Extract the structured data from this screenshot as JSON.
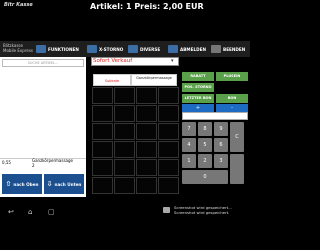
{
  "app": {
    "logo_text": "Bitr Kasse",
    "status_text": "Artikel: 1   Preis: 2,00 EUR"
  },
  "toolbar": {
    "title_line1": "Blitzkasse",
    "title_line2": "Mobile Express",
    "buttons": [
      {
        "label": "FUNKTIONEN",
        "icon": "grid-icon"
      },
      {
        "label": "X-STORNO",
        "icon": "x-storno-icon"
      },
      {
        "label": "DIVERSE",
        "icon": "diverse-icon"
      },
      {
        "label": "ABMELDEN",
        "icon": "logout-icon"
      },
      {
        "label": "BEENDEN",
        "icon": "power-icon"
      }
    ]
  },
  "left": {
    "search_placeholder": "SUCHE ARTIKEL...",
    "count_label": "0,55",
    "sum_label": "Ganzkörpermassage",
    "sum_value": "2",
    "nav_up": "nach Oben",
    "nav_down": "nach Unten"
  },
  "middle": {
    "select_value": "Sofort Verkauf",
    "tab_subkat": "Subkate",
    "tab_gesamt": "Ganzkörpermassage"
  },
  "keypad": {
    "green_buttons": [
      "RABATT",
      "PLUSEIN",
      "POS. STORNO",
      "LETZTER BON",
      "BON"
    ],
    "blue_buttons": [
      "+",
      "-"
    ],
    "keys": [
      "7",
      "8",
      "9",
      "C",
      "4",
      "5",
      "6",
      "1",
      "2",
      "3",
      "0"
    ]
  },
  "system": {
    "notification_line1": "Screenshot wird gespeichert...",
    "notification_line2": "Screenshot wird gespeichert."
  }
}
